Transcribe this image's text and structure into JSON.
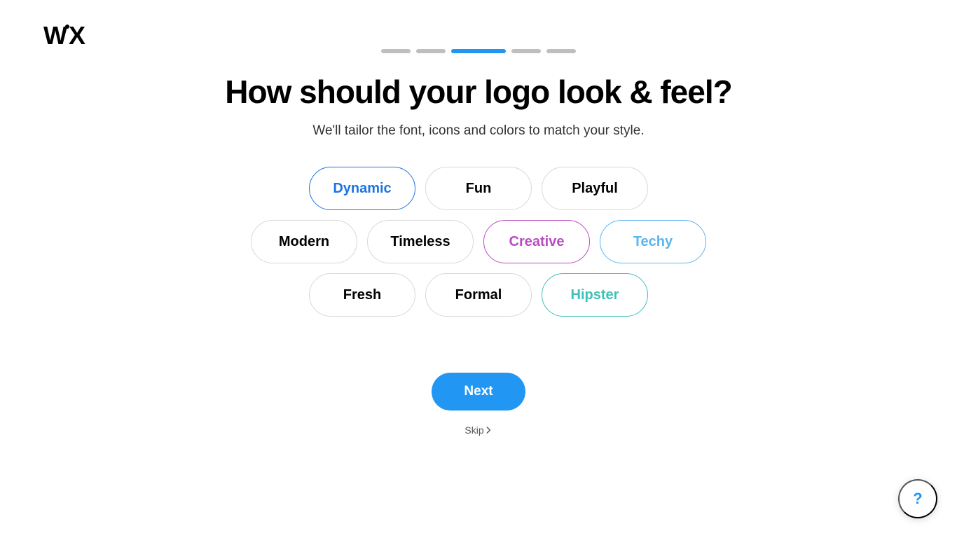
{
  "brand": "WiX",
  "progress": {
    "total": 5,
    "active_index": 2
  },
  "heading": "How should your logo look & feel?",
  "subheading": "We'll tailor the font, icons and colors to match your style.",
  "tags": {
    "rows": [
      [
        {
          "label": "Dynamic",
          "variant": "c-blue"
        },
        {
          "label": "Fun",
          "variant": ""
        },
        {
          "label": "Playful",
          "variant": ""
        }
      ],
      [
        {
          "label": "Modern",
          "variant": ""
        },
        {
          "label": "Timeless",
          "variant": ""
        },
        {
          "label": "Creative",
          "variant": "c-purple"
        },
        {
          "label": "Techy",
          "variant": "c-skyblue"
        }
      ],
      [
        {
          "label": "Fresh",
          "variant": ""
        },
        {
          "label": "Formal",
          "variant": ""
        },
        {
          "label": "Hipster",
          "variant": "c-teal"
        }
      ]
    ]
  },
  "next_label": "Next",
  "skip_label": "Skip",
  "help_label": "?"
}
